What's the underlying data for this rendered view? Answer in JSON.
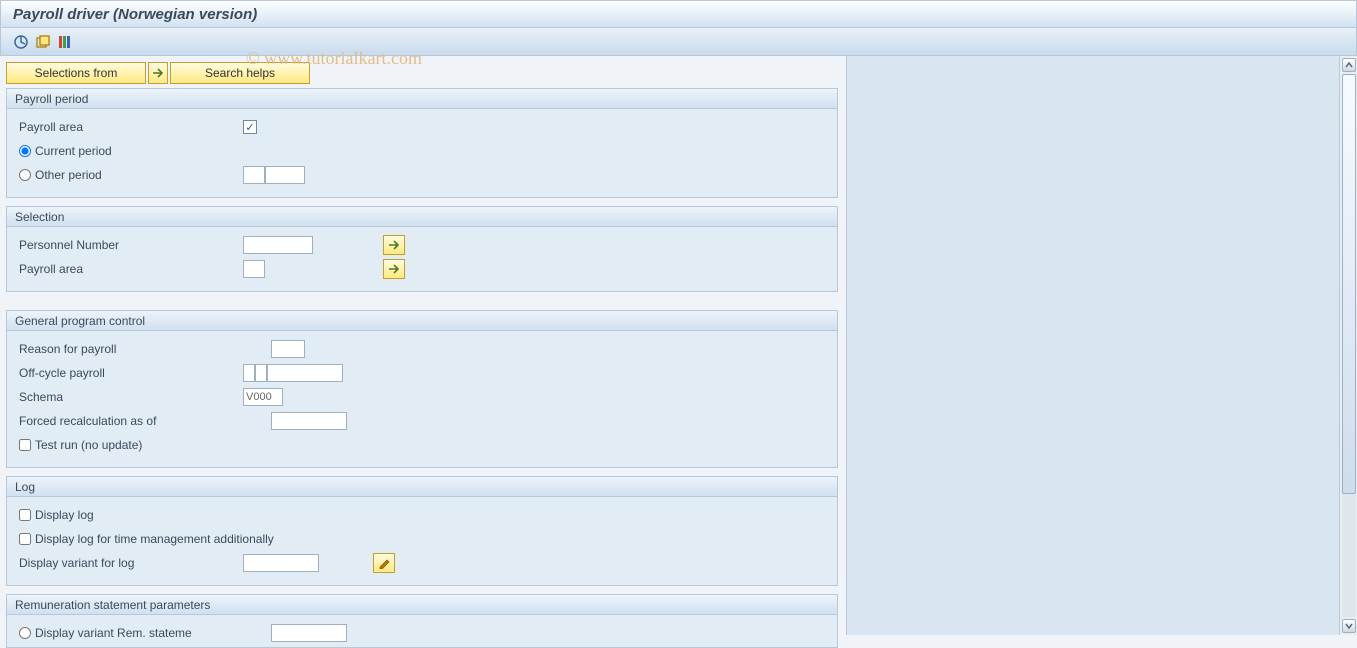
{
  "title": "Payroll driver (Norwegian version)",
  "watermark": "© www.tutorialkart.com",
  "buttons": {
    "selections_from": "Selections from",
    "search_helps": "Search helps"
  },
  "groups": {
    "payroll_period": {
      "header": "Payroll period",
      "payroll_area": "Payroll area",
      "current_period": "Current period",
      "other_period": "Other period"
    },
    "selection": {
      "header": "Selection",
      "personnel_number": "Personnel Number",
      "payroll_area": "Payroll area"
    },
    "general": {
      "header": "General program control",
      "reason_for_payroll": "Reason for payroll",
      "off_cycle_payroll": "Off-cycle payroll",
      "schema": "Schema",
      "schema_value": "V000",
      "forced_recalc": "Forced recalculation as of",
      "test_run": "Test run (no update)"
    },
    "log": {
      "header": "Log",
      "display_log": "Display log",
      "display_log_time": "Display log for time management additionally",
      "display_variant": "Display variant for log"
    },
    "remuneration": {
      "header": "Remuneration statement parameters",
      "display_variant_rem": "Display variant Rem. stateme"
    }
  }
}
